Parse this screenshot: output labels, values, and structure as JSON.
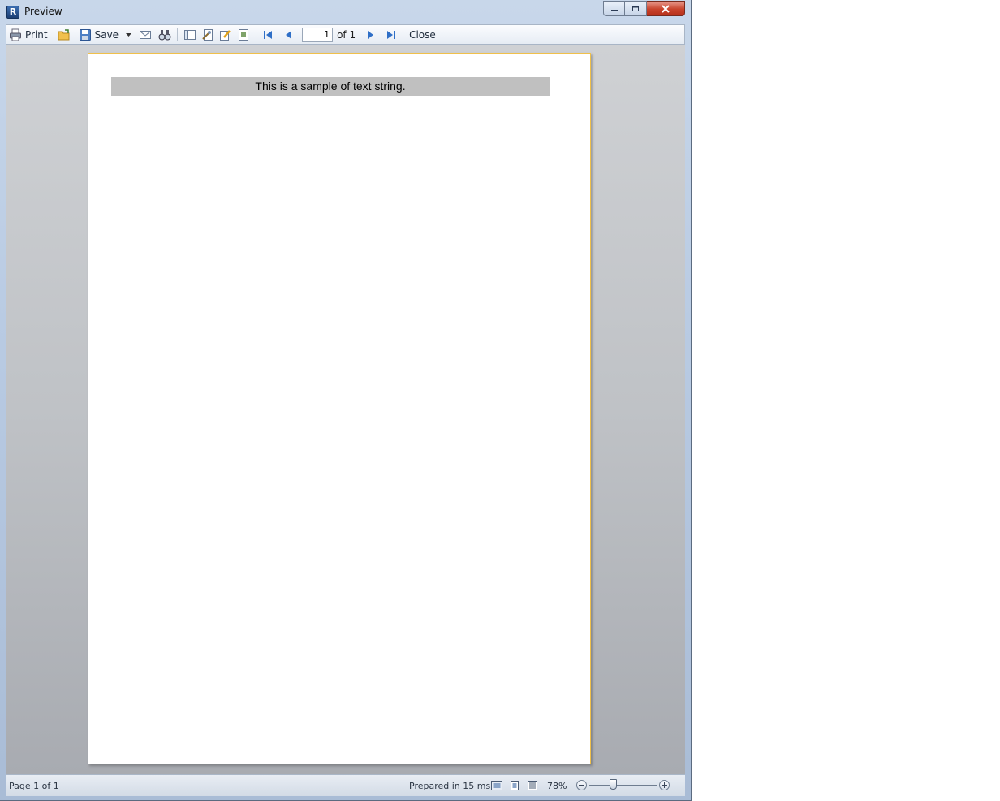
{
  "window": {
    "title": "Preview",
    "caption": {
      "minimize_icon": "minimize-icon",
      "maximize_icon": "maximize-icon",
      "close_icon": "close-icon"
    }
  },
  "toolbar": {
    "print_label": "Print",
    "save_label": "Save",
    "page_value": "1",
    "of_label": "of 1",
    "close_label": "Close",
    "icons": [
      "printer-icon",
      "open-folder-icon",
      "save-disk-icon",
      "dropdown-arrow-icon",
      "email-icon",
      "find-binoculars-icon",
      "outline-icon",
      "page-setup-icon",
      "edit-icon",
      "watermark-icon",
      "first-page-icon",
      "previous-page-icon",
      "next-page-icon",
      "last-page-icon"
    ]
  },
  "report": {
    "text": "This is a sample of text string."
  },
  "statusbar": {
    "page_info": "Page 1 of 1",
    "prepared": "Prepared in 15 ms",
    "zoom": "78%",
    "zoom_level": 0.5
  },
  "colors": {
    "page_border": "#f0c04a",
    "text_band": "#c0c0c0",
    "preview_bg": "#bfc2c6"
  }
}
